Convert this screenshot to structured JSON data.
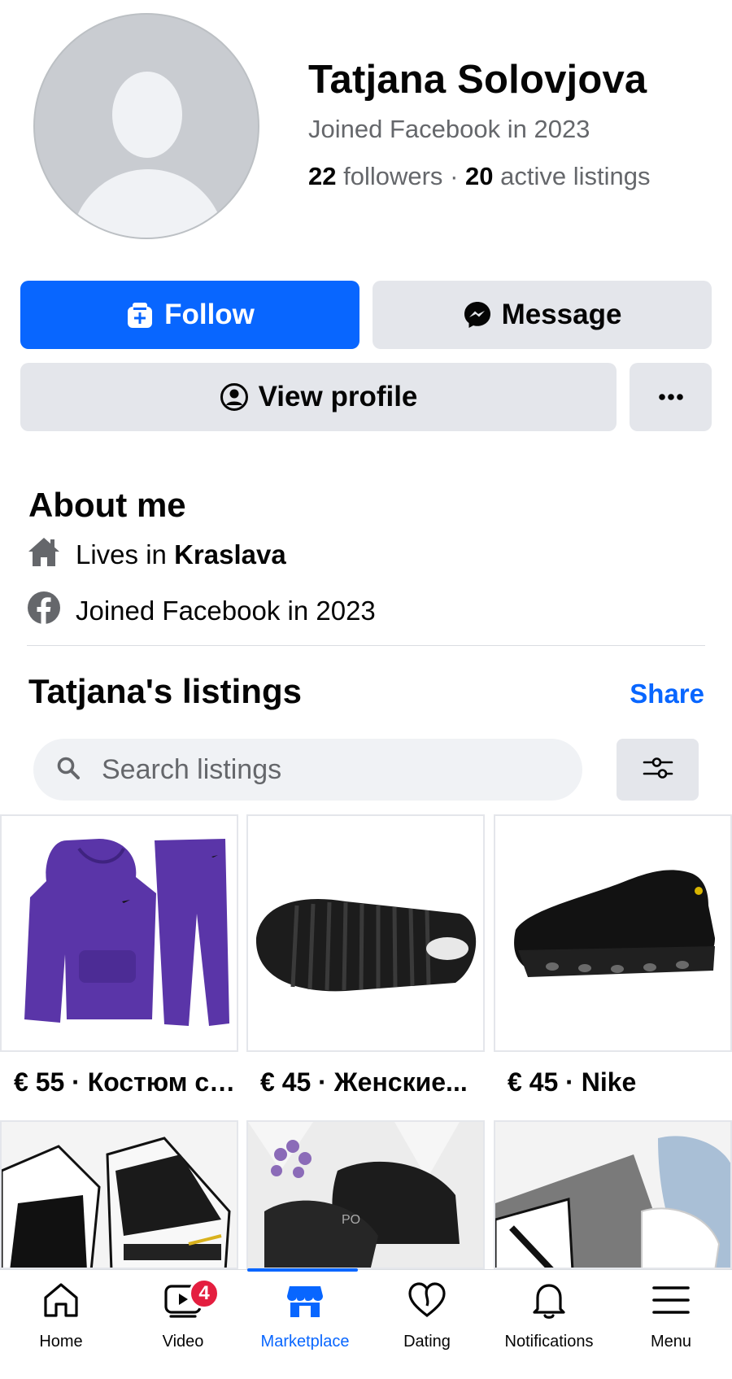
{
  "profile": {
    "name": "Tatjana Solovjova",
    "joined": "Joined Facebook in 2023",
    "followers_count": "22",
    "followers_label": "followers",
    "separator": "·",
    "listings_count": "20",
    "listings_label": "active listings"
  },
  "actions": {
    "follow_label": "Follow",
    "message_label": "Message",
    "view_profile_label": "View profile",
    "more_label": "···"
  },
  "about": {
    "title": "About me",
    "lives_prefix": "Lives in",
    "lives_city": "Kraslava",
    "joined": "Joined Facebook in 2023"
  },
  "listings": {
    "title": "Tatjana's listings",
    "share_label": "Share",
    "search_placeholder": "Search listings",
    "items": [
      {
        "price": "€ 55 · Костюм сп...",
        "image": "purple-tracksuit"
      },
      {
        "price": "€ 45 · Женские...",
        "image": "black-shoe-sole"
      },
      {
        "price": "€ 45 · Nike",
        "image": "black-nike-sneaker"
      },
      {
        "price": "",
        "image": "dior-sneakers"
      },
      {
        "price": "",
        "image": "black-sneakers-with-lavender"
      },
      {
        "price": "",
        "image": "white-sneakers-jeans"
      }
    ]
  },
  "nav": {
    "items": [
      {
        "label": "Home",
        "icon": "home-icon"
      },
      {
        "label": "Video",
        "icon": "video-icon",
        "badge": "4"
      },
      {
        "label": "Marketplace",
        "icon": "marketplace-icon",
        "active": true
      },
      {
        "label": "Dating",
        "icon": "dating-icon"
      },
      {
        "label": "Notifications",
        "icon": "bell-icon"
      },
      {
        "label": "Menu",
        "icon": "menu-icon"
      }
    ]
  },
  "colors": {
    "primary": "#0866ff",
    "button_gray": "#e4e6eb",
    "text_secondary": "#65676b",
    "badge_red": "#e41e3f"
  }
}
